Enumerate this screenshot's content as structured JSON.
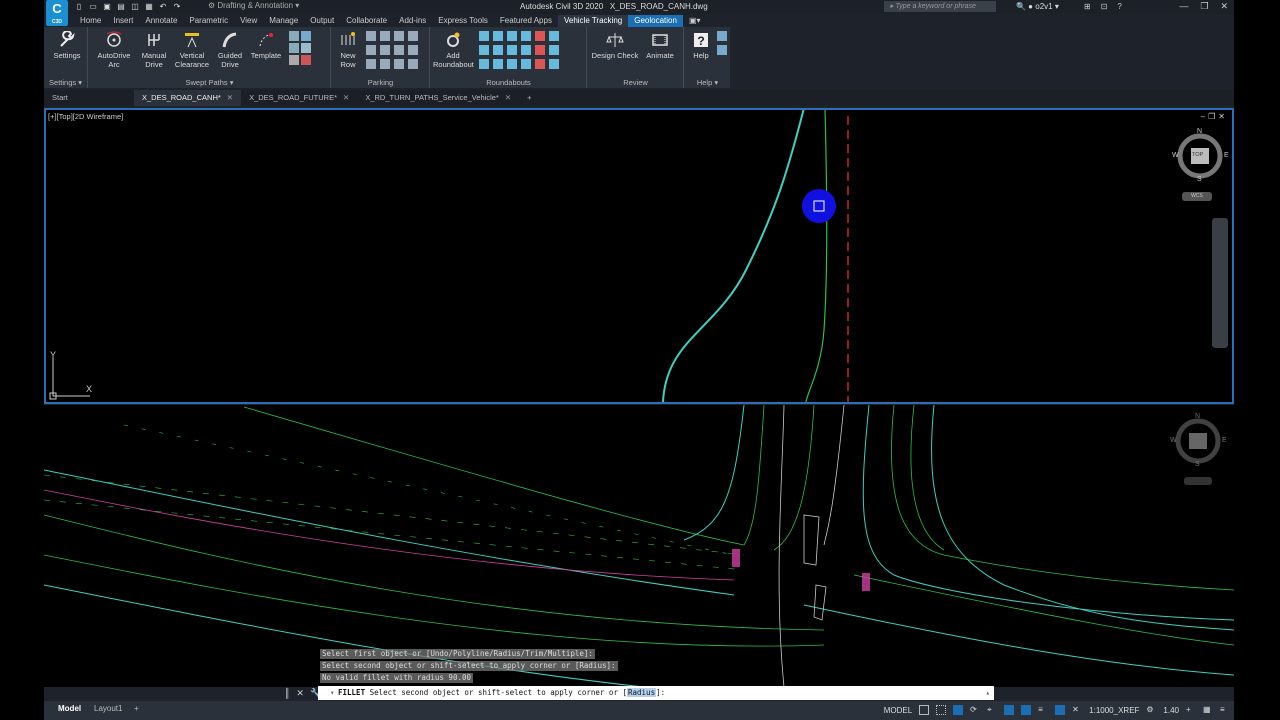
{
  "app": {
    "title": "Autodesk Civil 3D 2020",
    "filename": "X_DES_ROAD_CANH.dwg",
    "logo_text": "C",
    "logo_sub": "C3D",
    "workspace": "Drafting & Annotation",
    "search_placeholder": "Type a keyword or phrase",
    "user": "o2v1"
  },
  "ribbon_tabs": [
    "Home",
    "Insert",
    "Annotate",
    "Parametric",
    "View",
    "Manage",
    "Output",
    "Collaborate",
    "Add-ins",
    "Express Tools",
    "Featured Apps",
    "Vehicle Tracking",
    "Geolocation"
  ],
  "ribbon": {
    "settings": {
      "button": "Settings",
      "panel": "Settings"
    },
    "swept_paths": {
      "panel": "Swept Paths",
      "buttons": [
        "AutoDrive Arc",
        "Manual Drive",
        "Vertical Clearance",
        "Guided Drive",
        "Template"
      ]
    },
    "parking": {
      "panel": "Parking",
      "buttons": [
        "New Row"
      ]
    },
    "roundabouts": {
      "panel": "Roundabouts",
      "buttons": [
        "Add Roundabout"
      ]
    },
    "review": {
      "panel": "Review",
      "buttons": [
        "Design Check",
        "Animate"
      ]
    },
    "help": {
      "panel": "Help",
      "buttons": [
        "Help"
      ]
    }
  },
  "doc_tabs": [
    {
      "label": "Start",
      "active": false,
      "closable": false
    },
    {
      "label": "X_DES_ROAD_CANH*",
      "active": true,
      "closable": true
    },
    {
      "label": "X_DES_ROAD_FUTURE*",
      "active": false,
      "closable": true
    },
    {
      "label": "X_RD_TURN_PATHS_Service_Vehicle*",
      "active": false,
      "closable": true
    }
  ],
  "viewport_top": {
    "label": "[+][Top][2D Wireframe]",
    "compass": {
      "n": "N",
      "s": "S",
      "e": "E",
      "w": "W",
      "face": "TOP",
      "ucs": "WCS"
    },
    "ucs_x": "X",
    "ucs_y": "Y"
  },
  "viewport_bottom": {
    "compass": {
      "n": "N",
      "s": "S",
      "e": "E",
      "w": "W"
    }
  },
  "command": {
    "history": [
      "Select first object or [Undo/Polyline/Radius/Trim/Multiple]:",
      "Select second object or shift-select to apply corner or [Radius]:",
      "No valid fillet with radius 90.00"
    ],
    "prompt_cmd": "FILLET",
    "prompt_text": "Select second object or shift-select to apply corner or [",
    "prompt_option": "Radius",
    "prompt_end": "]:"
  },
  "statusbar": {
    "tabs": [
      "Model",
      "Layout1"
    ],
    "model_label": "MODEL",
    "scale": "1:1000_XREF",
    "zoom": "1.40"
  },
  "colors": {
    "cyan_line": "#3fd0c0",
    "green_line": "#2fbf4a",
    "red_line": "#ff3030",
    "magenta_line": "#d040a0",
    "accent": "#1a6fb5"
  }
}
